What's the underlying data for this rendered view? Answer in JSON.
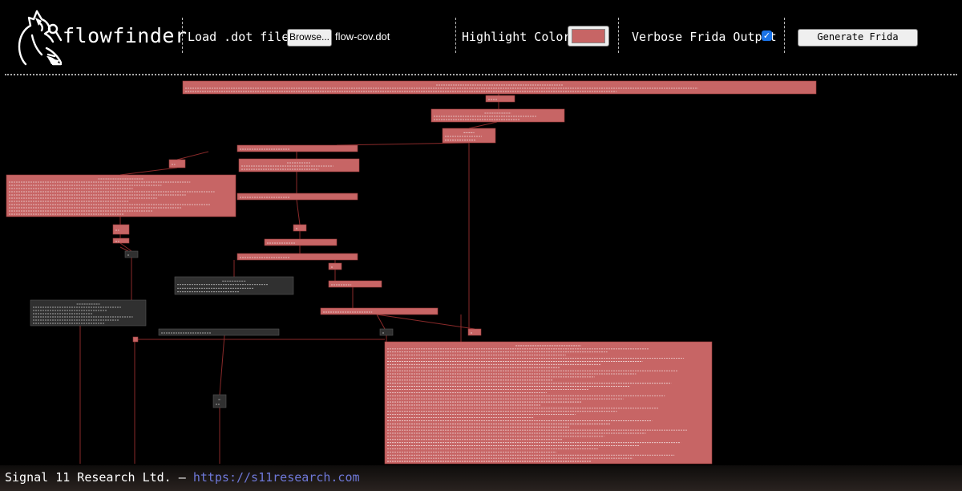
{
  "header": {
    "logo_text": "flowfinder",
    "load_label": "Load .dot file:",
    "browse_label": "Browse...",
    "file_name": "flow-cov.dot",
    "highlight_label": "Highlight Color:",
    "highlight_color": "#c76565",
    "verbose_label": "Verbose Frida Output",
    "verbose_checked": true,
    "generate_label": "Generate Frida Script"
  },
  "graph": {
    "highlight_fill": "#c76565",
    "plain_fill": "#303030",
    "edge_color": "#8a2a2a"
  },
  "footer": {
    "company": "Signal 11 Research Ltd. –",
    "link": "https://s11research.com"
  }
}
